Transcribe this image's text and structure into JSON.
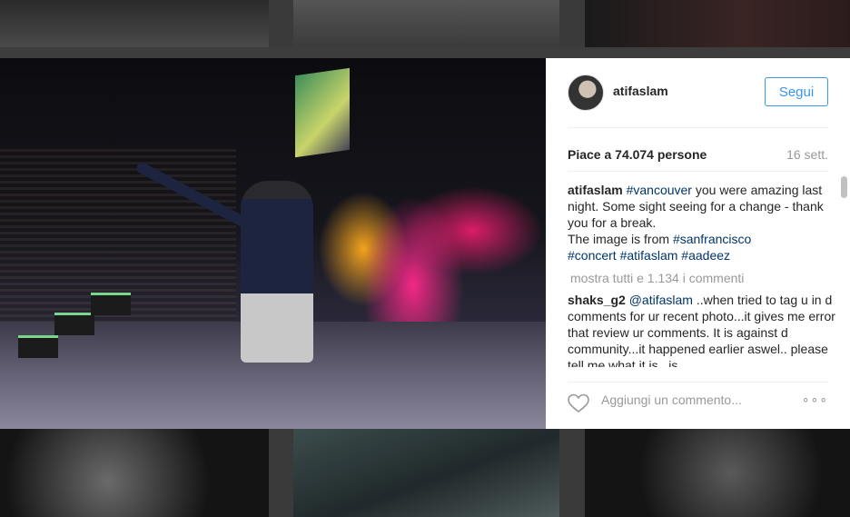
{
  "post": {
    "username": "atifaslam",
    "follow_label": "Segui",
    "likes": "Piace a 74.074 persone",
    "time": "16 sett.",
    "caption": {
      "username": "atifaslam",
      "parts": [
        {
          "text": "#vancouver",
          "tag": true
        },
        {
          "text": " you were amazing last night. Some sight seeing for a change - thank you for a break.\nThe image is from ",
          "tag": false
        },
        {
          "text": "#sanfrancisco",
          "tag": true
        },
        {
          "text": "\n",
          "tag": false
        },
        {
          "text": "#concert",
          "tag": true
        },
        {
          "text": " ",
          "tag": false
        },
        {
          "text": "#atifaslam",
          "tag": true
        },
        {
          "text": " ",
          "tag": false
        },
        {
          "text": "#aadeez",
          "tag": true
        }
      ]
    },
    "load_more": "mostra tutti e 1.134 i commenti",
    "comment": {
      "username": "shaks_g2",
      "mention": "@atifaslam",
      "text": " ..when tried to tag u in d comments for ur recent photo...it gives me error that review ur comments. It is against d community...it happened earlier aswel.. please tell me what it is.. is"
    },
    "add_comment_placeholder": "Aggiungi un commento...",
    "more_label": "∘∘∘"
  },
  "colors": {
    "accent": "#3897f0",
    "hashtag": "#003569",
    "muted": "#999999"
  },
  "icons": {
    "heart": "heart-icon",
    "more": "more-options-icon"
  }
}
